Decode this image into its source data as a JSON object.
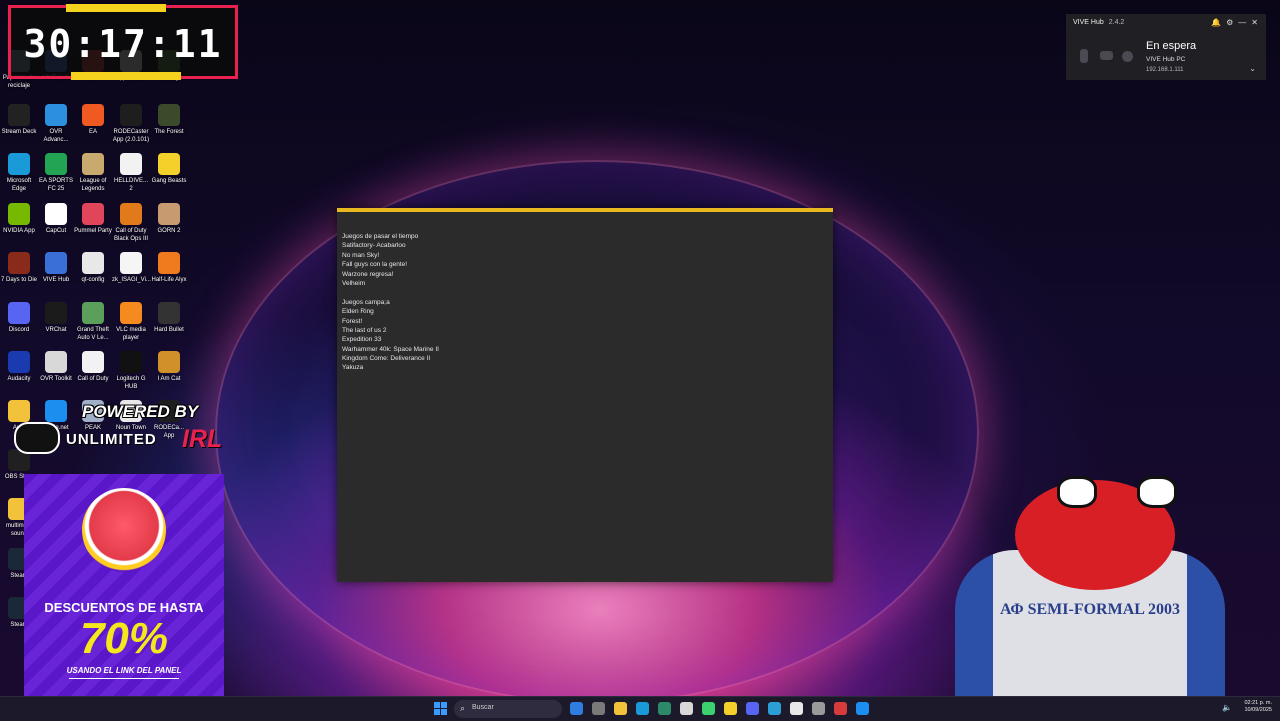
{
  "timer": {
    "value": "30:17:11"
  },
  "desktop_icons": [
    {
      "label": "Papelera de reciclaje",
      "color": "#7a8aa0"
    },
    {
      "label": "VIVE Hub",
      "color": "#3a6fd8"
    },
    {
      "label": "Riot",
      "color": "#d13639"
    },
    {
      "label": "App Wind...",
      "color": "#e2e2e2"
    },
    {
      "label": "Half-Days",
      "color": "#4a7f3a"
    },
    {
      "label": "Stream Deck",
      "color": "#222222"
    },
    {
      "label": "OVR Advanc...",
      "color": "#2c8fe0"
    },
    {
      "label": "EA",
      "color": "#f05a22"
    },
    {
      "label": "RODECaster App (2.0.101)",
      "color": "#1e1e1e"
    },
    {
      "label": "The Forest",
      "color": "#3b4a2a"
    },
    {
      "label": "Microsoft Edge",
      "color": "#1a9bd7"
    },
    {
      "label": "EA SPORTS FC 25",
      "color": "#23a455"
    },
    {
      "label": "League of Legends",
      "color": "#c8aa6e"
    },
    {
      "label": "HELLDIVE... 2",
      "color": "#f2f2f2"
    },
    {
      "label": "Gang Beasts",
      "color": "#f3d02a"
    },
    {
      "label": "NVIDIA App",
      "color": "#76b900"
    },
    {
      "label": "CapCut",
      "color": "#ffffff"
    },
    {
      "label": "Pummel Party",
      "color": "#e0455a"
    },
    {
      "label": "Call of Duty Black Ops III",
      "color": "#e07a1a"
    },
    {
      "label": "GORN 2",
      "color": "#c89a70"
    },
    {
      "label": "7 Days to Die",
      "color": "#8a2a1a"
    },
    {
      "label": "VIVE Hub",
      "color": "#3a6fd8"
    },
    {
      "label": "qt-config",
      "color": "#e8e8e8"
    },
    {
      "label": "zk_ISAGI_Vi...",
      "color": "#f5f5f5"
    },
    {
      "label": "Half-Life Alyx",
      "color": "#f07a1e"
    },
    {
      "label": "Discord",
      "color": "#5865f2"
    },
    {
      "label": "VRChat",
      "color": "#1b1b1b"
    },
    {
      "label": "Grand Theft Auto V Le...",
      "color": "#5aa05a"
    },
    {
      "label": "VLC media player",
      "color": "#f58a1f"
    },
    {
      "label": "Hard Bullet",
      "color": "#333333"
    },
    {
      "label": "Audacity",
      "color": "#1a3bb0"
    },
    {
      "label": "OVR Toolkit",
      "color": "#d8d8d8"
    },
    {
      "label": "Call of Duty",
      "color": "#f2f2f2"
    },
    {
      "label": "Logitech G HUB",
      "color": "#111111"
    },
    {
      "label": "I Am Cat",
      "color": "#d0902a"
    },
    {
      "label": "Au...",
      "color": "#f2c33a"
    },
    {
      "label": "Battle.net",
      "color": "#1c8ef0"
    },
    {
      "label": "PEAK",
      "color": "#9fb0c8"
    },
    {
      "label": "Noun Town",
      "color": "#e8e8e8"
    },
    {
      "label": "RODECa... App",
      "color": "#1e1e1e"
    },
    {
      "label": "OBS Stu...",
      "color": "#202020"
    },
    {
      "label": "multime... sound",
      "color": "#f2c33a"
    },
    {
      "label": "Steam",
      "color": "#1b2838"
    },
    {
      "label": "Steam",
      "color": "#1b2838"
    }
  ],
  "notepad": {
    "lines": [
      "Juegos de pasar el tiempo",
      "Satifactory- Acabarloo",
      "No man Sky!",
      "Fall guys con la gente!",
      "Warzone regresa!",
      "Velheim",
      "",
      "Juegos campa;a",
      "Elden Ring",
      "Forest!",
      "The last of us 2",
      "Expedition 33",
      "Warhammer 40k: Space Marine II",
      "Kingdom Come: Deliverance II",
      "Yakuza"
    ]
  },
  "vive_hub": {
    "title": "VIVE Hub",
    "version": "2.4.2",
    "status": "En espera",
    "pc_name": "VIVE Hub PC",
    "ip": "192.168.1.111"
  },
  "overlay": {
    "powered_by": "POWERED BY",
    "unlimited": "UNLIMITED",
    "irl": "IRL"
  },
  "promo": {
    "line1": "DESCUENTOS DE HASTA",
    "percent": "70%",
    "line2": "USANDO EL LINK DEL PANEL",
    "brand": "eneba"
  },
  "avatar": {
    "shirt_text": "ΑΦ SEMI-FORMAL 2003"
  },
  "taskbar": {
    "search_placeholder": "Buscar",
    "time": "02:21 p. m.",
    "date": "10/09/2025",
    "apps": [
      "#2f7de0",
      "#7a7a7a",
      "#f2c33a",
      "#1a9bd7",
      "#2c8a6a",
      "#d8d8d8",
      "#3bd16f",
      "#f3d02a",
      "#5865f2",
      "#2a9fd6",
      "#e8e8e8",
      "#9a9a9a",
      "#d83b3b",
      "#1c8ef0"
    ]
  }
}
